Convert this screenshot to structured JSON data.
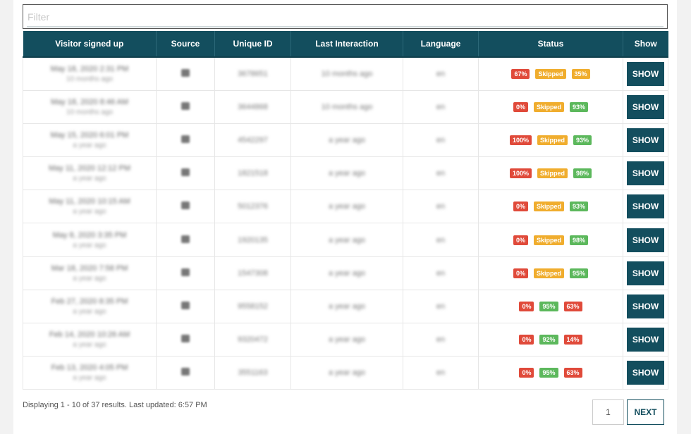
{
  "filter": {
    "placeholder": "Filter",
    "value": ""
  },
  "columns": [
    "Visitor signed up",
    "Source",
    "Unique ID",
    "Last Interaction",
    "Language",
    "Status",
    "Show"
  ],
  "show_label": "SHOW",
  "colors": {
    "header": "#134e5e",
    "red": "#e04a3a",
    "orange": "#f0ad2e",
    "green": "#5cb85c"
  },
  "rows": [
    {
      "signed_up": "May 18, 2020 2:31 PM",
      "signed_ago": "10 months ago",
      "unique_id": "3678651",
      "last_interaction": "10 months ago",
      "language": "en",
      "status": [
        {
          "text": "67%",
          "color": "red"
        },
        {
          "text": "Skipped",
          "color": "orange"
        },
        {
          "text": "35%",
          "color": "orange"
        }
      ]
    },
    {
      "signed_up": "May 18, 2020 8:46 AM",
      "signed_ago": "10 months ago",
      "unique_id": "3644868",
      "last_interaction": "10 months ago",
      "language": "en",
      "status": [
        {
          "text": "0%",
          "color": "red"
        },
        {
          "text": "Skipped",
          "color": "orange"
        },
        {
          "text": "93%",
          "color": "green"
        }
      ]
    },
    {
      "signed_up": "May 15, 2020 6:01 PM",
      "signed_ago": "a year ago",
      "unique_id": "4542297",
      "last_interaction": "a year ago",
      "language": "en",
      "status": [
        {
          "text": "100%",
          "color": "red"
        },
        {
          "text": "Skipped",
          "color": "orange"
        },
        {
          "text": "93%",
          "color": "green"
        }
      ]
    },
    {
      "signed_up": "May 11, 2020 12:12 PM",
      "signed_ago": "a year ago",
      "unique_id": "1821518",
      "last_interaction": "a year ago",
      "language": "en",
      "status": [
        {
          "text": "100%",
          "color": "red"
        },
        {
          "text": "Skipped",
          "color": "orange"
        },
        {
          "text": "98%",
          "color": "green"
        }
      ]
    },
    {
      "signed_up": "May 11, 2020 10:15 AM",
      "signed_ago": "a year ago",
      "unique_id": "5012376",
      "last_interaction": "a year ago",
      "language": "en",
      "status": [
        {
          "text": "0%",
          "color": "red"
        },
        {
          "text": "Skipped",
          "color": "orange"
        },
        {
          "text": "93%",
          "color": "green"
        }
      ]
    },
    {
      "signed_up": "May 8, 2020 3:35 PM",
      "signed_ago": "a year ago",
      "unique_id": "1920135",
      "last_interaction": "a year ago",
      "language": "en",
      "status": [
        {
          "text": "0%",
          "color": "red"
        },
        {
          "text": "Skipped",
          "color": "orange"
        },
        {
          "text": "98%",
          "color": "green"
        }
      ]
    },
    {
      "signed_up": "Mar 18, 2020 7:58 PM",
      "signed_ago": "a year ago",
      "unique_id": "1547308",
      "last_interaction": "a year ago",
      "language": "en",
      "status": [
        {
          "text": "0%",
          "color": "red"
        },
        {
          "text": "Skipped",
          "color": "orange"
        },
        {
          "text": "95%",
          "color": "green"
        }
      ]
    },
    {
      "signed_up": "Feb 27, 2020 8:35 PM",
      "signed_ago": "a year ago",
      "unique_id": "9558152",
      "last_interaction": "a year ago",
      "language": "en",
      "status": [
        {
          "text": "0%",
          "color": "red"
        },
        {
          "text": "95%",
          "color": "green"
        },
        {
          "text": "63%",
          "color": "red"
        }
      ]
    },
    {
      "signed_up": "Feb 14, 2020 10:26 AM",
      "signed_ago": "a year ago",
      "unique_id": "9320472",
      "last_interaction": "a year ago",
      "language": "en",
      "status": [
        {
          "text": "0%",
          "color": "red"
        },
        {
          "text": "92%",
          "color": "green"
        },
        {
          "text": "14%",
          "color": "red"
        }
      ]
    },
    {
      "signed_up": "Feb 13, 2020 4:05 PM",
      "signed_ago": "a year ago",
      "unique_id": "3551163",
      "last_interaction": "a year ago",
      "language": "en",
      "status": [
        {
          "text": "0%",
          "color": "red"
        },
        {
          "text": "95%",
          "color": "green"
        },
        {
          "text": "63%",
          "color": "red"
        }
      ]
    }
  ],
  "footer": {
    "summary": "Displaying 1 - 10 of 37 results. Last updated: 6:57 PM",
    "page": "1",
    "next_label": "NEXT"
  }
}
